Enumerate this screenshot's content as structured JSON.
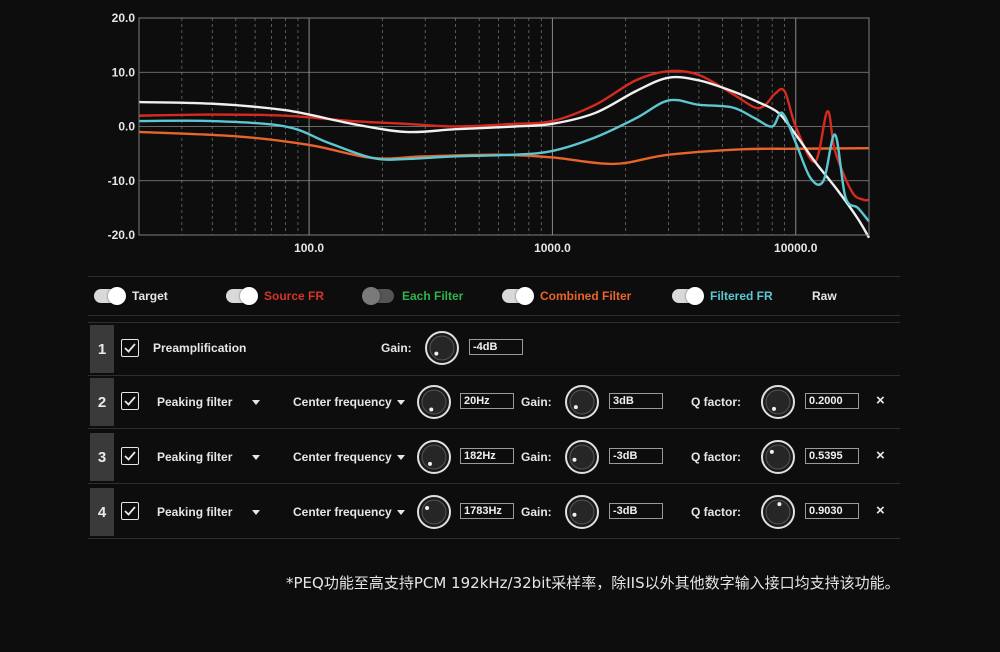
{
  "chart_data": {
    "type": "line",
    "x_scale": "log",
    "xlim": [
      20,
      20000
    ],
    "ylim": [
      -20,
      20
    ],
    "x_ticks": [
      100,
      1000,
      10000
    ],
    "x_tick_labels": [
      "100.0",
      "1000.0",
      "10000.0"
    ],
    "y_ticks": [
      20,
      10,
      0,
      -10,
      -20
    ],
    "y_tick_labels": [
      "20.0",
      "10.0",
      "0.0",
      "-10.0",
      "-20.0"
    ],
    "grid": true,
    "series": [
      {
        "name": "Combined Filter",
        "color": "#e8642c",
        "x": [
          20,
          50,
          100,
          182,
          300,
          600,
          1000,
          1783,
          3000,
          6000,
          10000,
          20000
        ],
        "y": [
          -1,
          -1.8,
          -3.4,
          -5.8,
          -5.5,
          -5.2,
          -5.7,
          -6.9,
          -5.2,
          -4.2,
          -4.1,
          -4.0
        ]
      },
      {
        "name": "Source FR",
        "color": "#d42b1e",
        "x": [
          20,
          40,
          80,
          150,
          250,
          400,
          700,
          1000,
          1500,
          2200,
          3000,
          4000,
          5500,
          6800,
          7500,
          8200,
          9000,
          10000,
          12000,
          13500,
          14500,
          17000,
          19000,
          20000
        ],
        "y": [
          2,
          2.2,
          2.0,
          1.0,
          0.5,
          0,
          0.5,
          1,
          4,
          8.5,
          10.2,
          9.5,
          6,
          3.5,
          4,
          6,
          6.5,
          0,
          -6.5,
          2.8,
          -4.5,
          -12,
          -13.5,
          -13.5
        ]
      },
      {
        "name": "Target",
        "color": "#f0f0f0",
        "x": [
          20,
          40,
          80,
          150,
          250,
          400,
          700,
          1000,
          1500,
          2200,
          3000,
          4000,
          5500,
          7000,
          8500,
          10000,
          12000,
          15000,
          18000,
          20000
        ],
        "y": [
          4.5,
          4.2,
          3.0,
          0.5,
          -1.0,
          -0.5,
          0,
          0.5,
          2.5,
          6.5,
          9.0,
          8.5,
          6.5,
          4.5,
          2.5,
          -1.5,
          -6.5,
          -12,
          -17,
          -20.5
        ]
      },
      {
        "name": "Filtered FR",
        "color": "#5cc7d1",
        "x": [
          20,
          40,
          80,
          120,
          182,
          250,
          400,
          700,
          1000,
          1500,
          2200,
          3000,
          4000,
          5500,
          6800,
          8000,
          8800,
          10000,
          11500,
          13000,
          14500,
          16000,
          18000,
          20000
        ],
        "y": [
          1,
          1,
          0,
          -3.0,
          -5.8,
          -6.0,
          -5.5,
          -5.2,
          -4.5,
          -2.0,
          1.5,
          4.8,
          4.0,
          3.5,
          1.5,
          0,
          2.5,
          -3,
          -9.5,
          -10,
          -1.5,
          -13,
          -15,
          -17.5
        ]
      }
    ]
  },
  "legend": [
    {
      "label": "Target",
      "color": "#e6e6e6",
      "on": true
    },
    {
      "label": "Source FR",
      "color": "#d7332a",
      "on": true
    },
    {
      "label": "Each Filter",
      "color": "#2fb34a",
      "on": false
    },
    {
      "label": "Combined Filter",
      "color": "#e8642c",
      "on": true
    },
    {
      "label": "Filtered FR",
      "color": "#5cc7d1",
      "on": true
    },
    {
      "label": "Raw",
      "color": "#e6e6e6"
    }
  ],
  "preamp": {
    "num": "1",
    "label": "Preamplification",
    "gain_label": "Gain:",
    "gain_value": "-4dB"
  },
  "filters": [
    {
      "num": "2",
      "type": "Peaking filter",
      "freq_label": "Center frequency",
      "freq": "20Hz",
      "gain_label": "Gain:",
      "gain": "3dB",
      "q_label": "Q factor:",
      "q": "0.2000"
    },
    {
      "num": "3",
      "type": "Peaking filter",
      "freq_label": "Center frequency",
      "freq": "182Hz",
      "gain_label": "Gain:",
      "gain": "-3dB",
      "q_label": "Q factor:",
      "q": "0.5395"
    },
    {
      "num": "4",
      "type": "Peaking filter",
      "freq_label": "Center frequency",
      "freq": "1783Hz",
      "gain_label": "Gain:",
      "gain": "-3dB",
      "q_label": "Q factor:",
      "q": "0.9030"
    }
  ],
  "remove_symbol": "×",
  "footnote": "*PEQ功能至高支持PCM 192kHz/32bit采样率，除IIS以外其他数字输入接口均支持该功能。"
}
